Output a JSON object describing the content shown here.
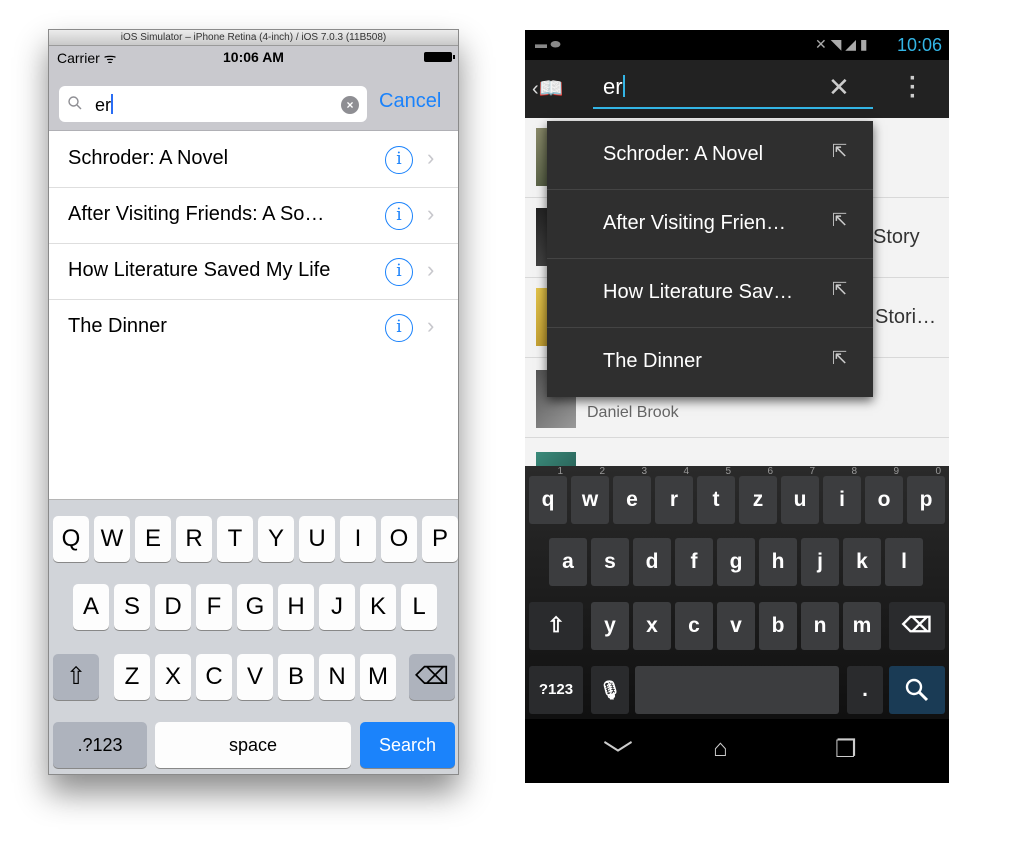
{
  "ios": {
    "simulator_title": "iOS Simulator – iPhone Retina (4-inch) / iOS 7.0.3 (11B508)",
    "carrier": "Carrier",
    "time": "10:06 AM",
    "search": {
      "value": "er",
      "cancel_label": "Cancel"
    },
    "results": [
      {
        "label": "Schroder: A Novel"
      },
      {
        "label": "After Visiting Friends: A So…"
      },
      {
        "label": "How Literature Saved My Life"
      },
      {
        "label": "The Dinner"
      }
    ],
    "keyboard": {
      "row1": [
        "Q",
        "W",
        "E",
        "R",
        "T",
        "Y",
        "U",
        "I",
        "O",
        "P"
      ],
      "row2": [
        "A",
        "S",
        "D",
        "F",
        "G",
        "H",
        "J",
        "K",
        "L"
      ],
      "row3": [
        "Z",
        "X",
        "C",
        "V",
        "B",
        "N",
        "M"
      ],
      "numbers_label": ".?123",
      "space_label": "space",
      "search_label": "Search",
      "shift_glyph": "⇧",
      "delete_glyph": "⌫"
    }
  },
  "android": {
    "time": "10:06",
    "search": {
      "value": "er",
      "clear_glyph": "✕"
    },
    "suggestions": [
      {
        "label": "Schroder: A Novel"
      },
      {
        "label": "After Visiting Frien…"
      },
      {
        "label": "How Literature Sav…"
      },
      {
        "label": "The Dinner"
      }
    ],
    "background_list": {
      "row2_tail": "Story",
      "row3_tail": "Stori…",
      "row4_author": "Daniel Brook"
    },
    "keyboard": {
      "row1": [
        {
          "k": "q",
          "h": "1"
        },
        {
          "k": "w",
          "h": "2"
        },
        {
          "k": "e",
          "h": "3"
        },
        {
          "k": "r",
          "h": "4"
        },
        {
          "k": "t",
          "h": "5"
        },
        {
          "k": "z",
          "h": "6"
        },
        {
          "k": "u",
          "h": "7"
        },
        {
          "k": "i",
          "h": "8"
        },
        {
          "k": "o",
          "h": "9"
        },
        {
          "k": "p",
          "h": "0"
        }
      ],
      "row2": [
        "a",
        "s",
        "d",
        "f",
        "g",
        "h",
        "j",
        "k",
        "l"
      ],
      "row3": [
        "y",
        "x",
        "c",
        "v",
        "b",
        "n",
        "m"
      ],
      "numbers_label": "?123",
      "period_label": ".",
      "shift_glyph": "⇧",
      "delete_glyph": "⌫",
      "mic_glyph": "🎤",
      "search_glyph": "⌕"
    }
  }
}
